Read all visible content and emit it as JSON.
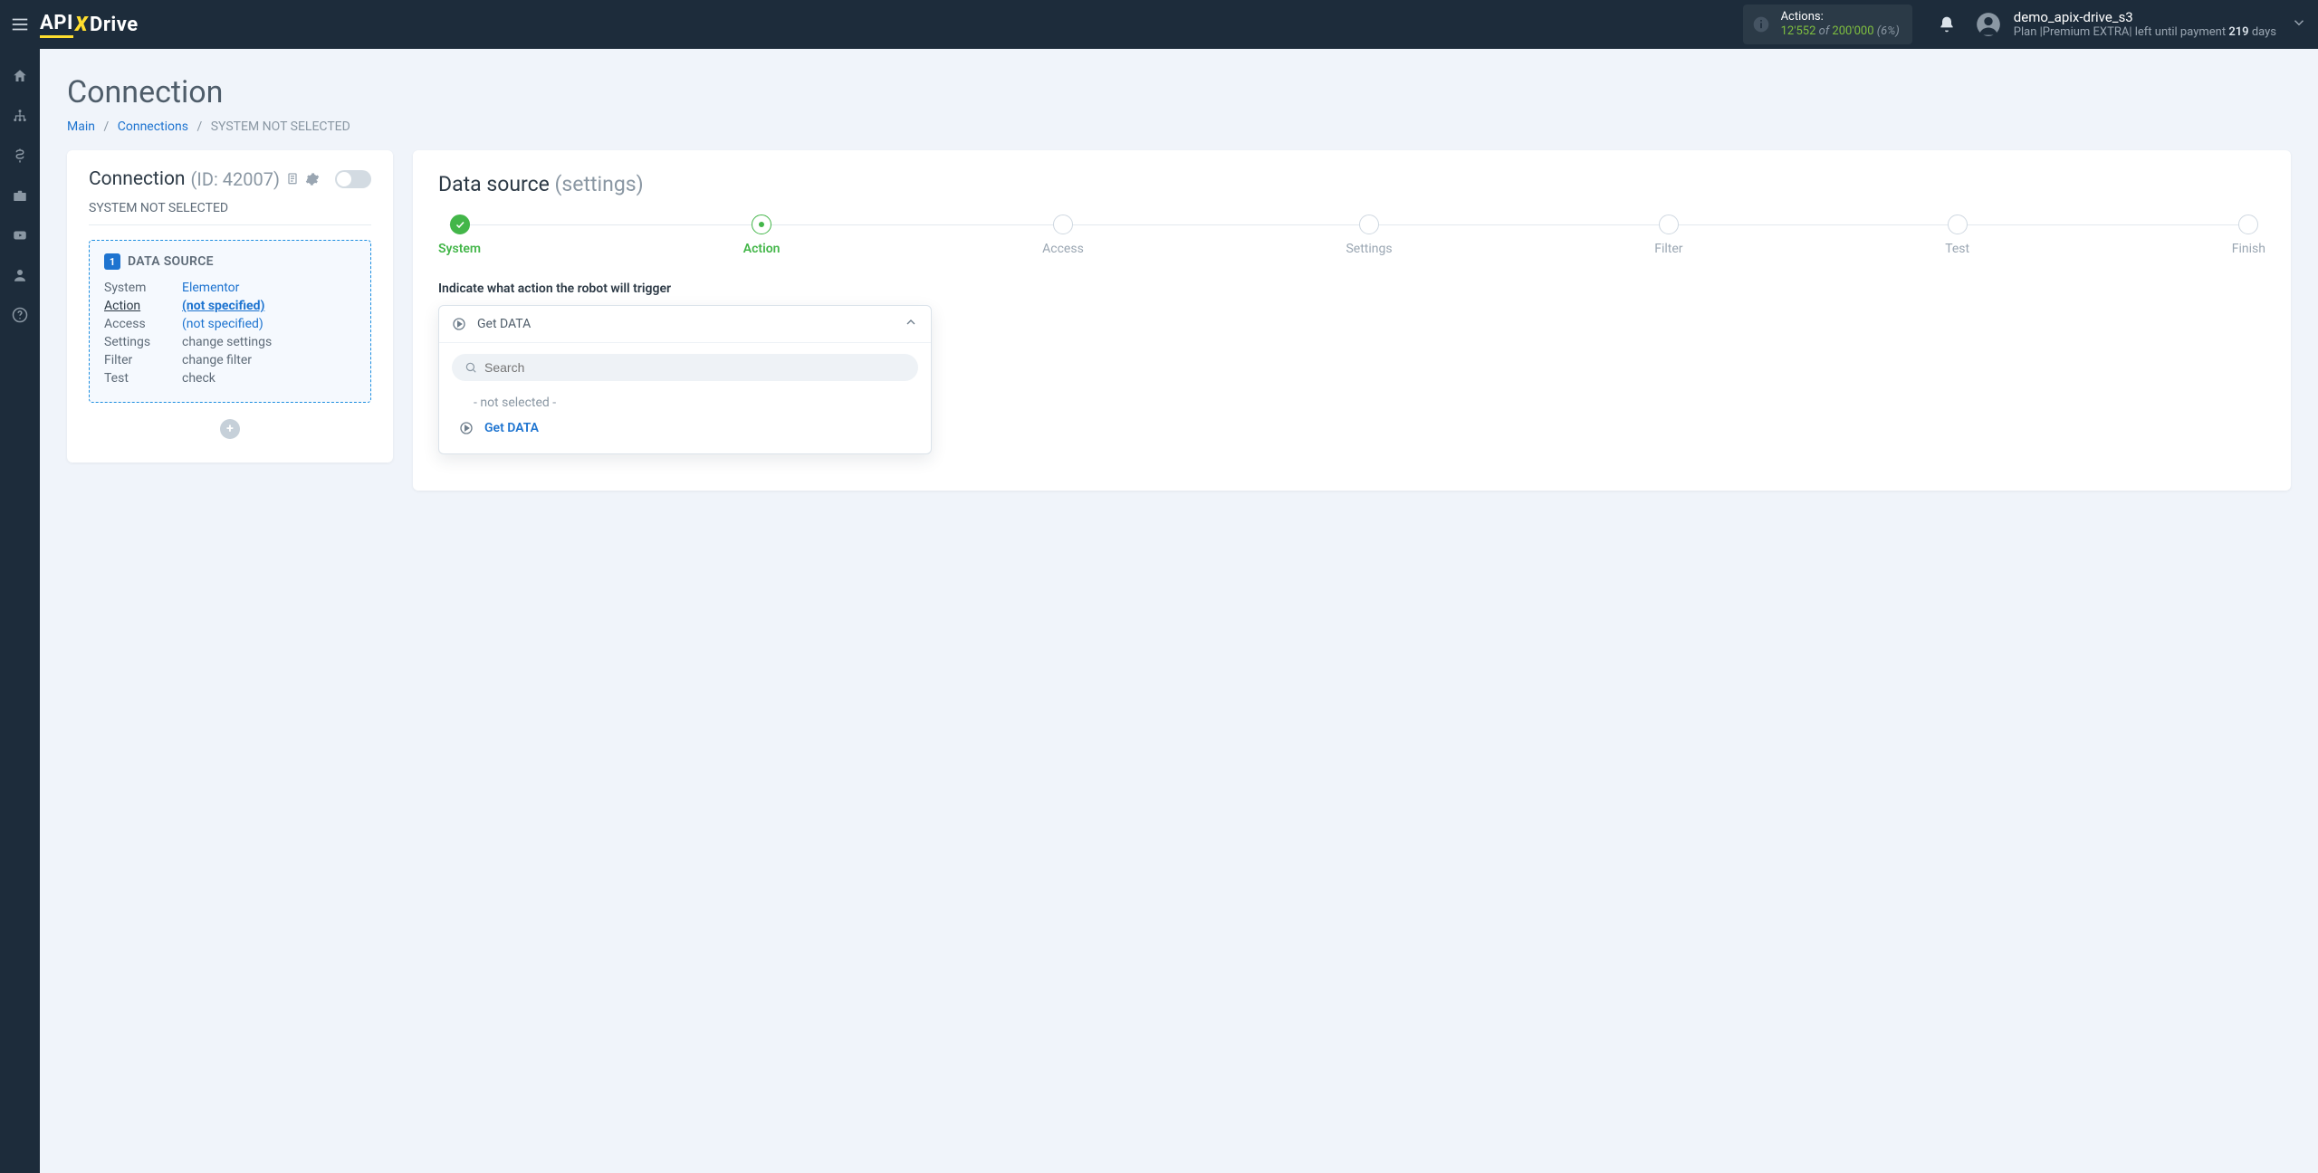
{
  "header": {
    "logo_part1": "API",
    "logo_x": "X",
    "logo_part2": "Drive",
    "actions_label": "Actions:",
    "actions_used": "12'552",
    "actions_of": "of",
    "actions_limit": "200'000",
    "actions_pct": "(6%)",
    "username": "demo_apix-drive_s3",
    "plan_prefix": "Plan |",
    "plan_name": "Premium EXTRA",
    "plan_mid": "| left until payment ",
    "plan_days": "219",
    "plan_suffix": " days"
  },
  "page": {
    "title": "Connection",
    "breadcrumb": {
      "main": "Main",
      "connections": "Connections",
      "current": "SYSTEM NOT SELECTED"
    }
  },
  "left": {
    "heading": "Connection",
    "id_label": "(ID: 42007)",
    "subhead": "SYSTEM NOT SELECTED",
    "ds_badge": "1",
    "ds_title": "DATA SOURCE",
    "rows": {
      "system_k": "System",
      "system_v": "Elementor",
      "action_k": "Action",
      "action_v": "(not specified)",
      "access_k": "Access",
      "access_v": "(not specified)",
      "settings_k": "Settings",
      "settings_v": "change settings",
      "filter_k": "Filter",
      "filter_v": "change filter",
      "test_k": "Test",
      "test_v": "check"
    }
  },
  "right": {
    "heading": "Data source",
    "heading_muted": "(settings)",
    "steps": [
      "System",
      "Action",
      "Access",
      "Settings",
      "Filter",
      "Test",
      "Finish"
    ],
    "field_label": "Indicate what action the robot will trigger",
    "dd_value": "Get DATA",
    "dd_search_placeholder": "Search",
    "dd_not_selected": "- not selected -",
    "dd_option1": "Get DATA"
  }
}
